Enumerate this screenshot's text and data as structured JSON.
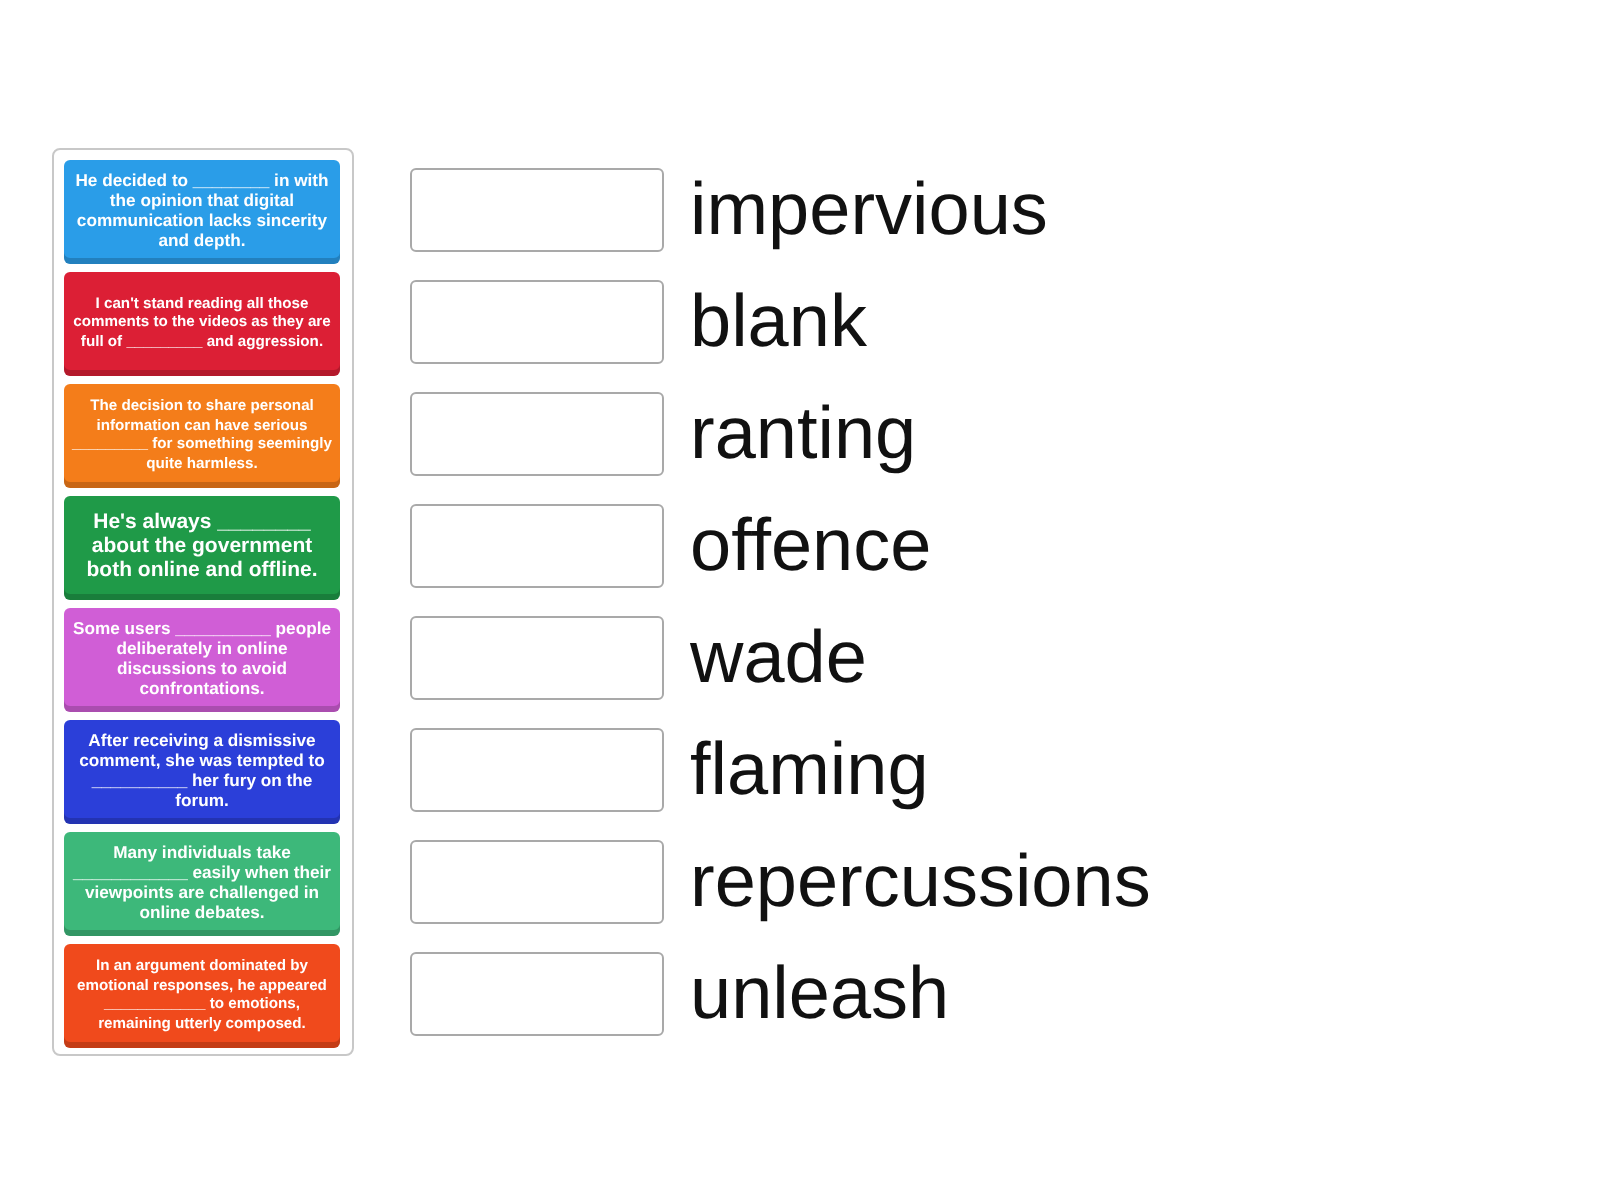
{
  "cards": [
    {
      "text": "He decided to ________ in with the opinion that digital communication lacks sincerity and depth.",
      "color": "#2a9de8"
    },
    {
      "text": "I can't stand reading all those comments to the videos as they are full of _________ and aggression.",
      "color": "#dc1f35"
    },
    {
      "text": "The decision to share personal information can have serious _________ for something seemingly quite harmless.",
      "color": "#f47d1a"
    },
    {
      "text": "He's always ________ about the government both online and offline.",
      "color": "#1f9a48"
    },
    {
      "text": "Some users __________ people deliberately in online discussions to avoid confrontations.",
      "color": "#d05ed6"
    },
    {
      "text": "After receiving a dismissive comment, she was tempted to __________ her fury on the forum.",
      "color": "#2b3fd9"
    },
    {
      "text": "Many individuals take ____________ easily when their viewpoints are challenged in online debates.",
      "color": "#3db87a"
    },
    {
      "text": "In an argument dominated by emotional responses, he appeared ____________ to emotions, remaining utterly composed.",
      "color": "#f04a1c"
    }
  ],
  "targets": [
    {
      "word": "impervious"
    },
    {
      "word": "blank"
    },
    {
      "word": "ranting"
    },
    {
      "word": "offence"
    },
    {
      "word": "wade"
    },
    {
      "word": "flaming"
    },
    {
      "word": "repercussions"
    },
    {
      "word": "unleash"
    }
  ]
}
